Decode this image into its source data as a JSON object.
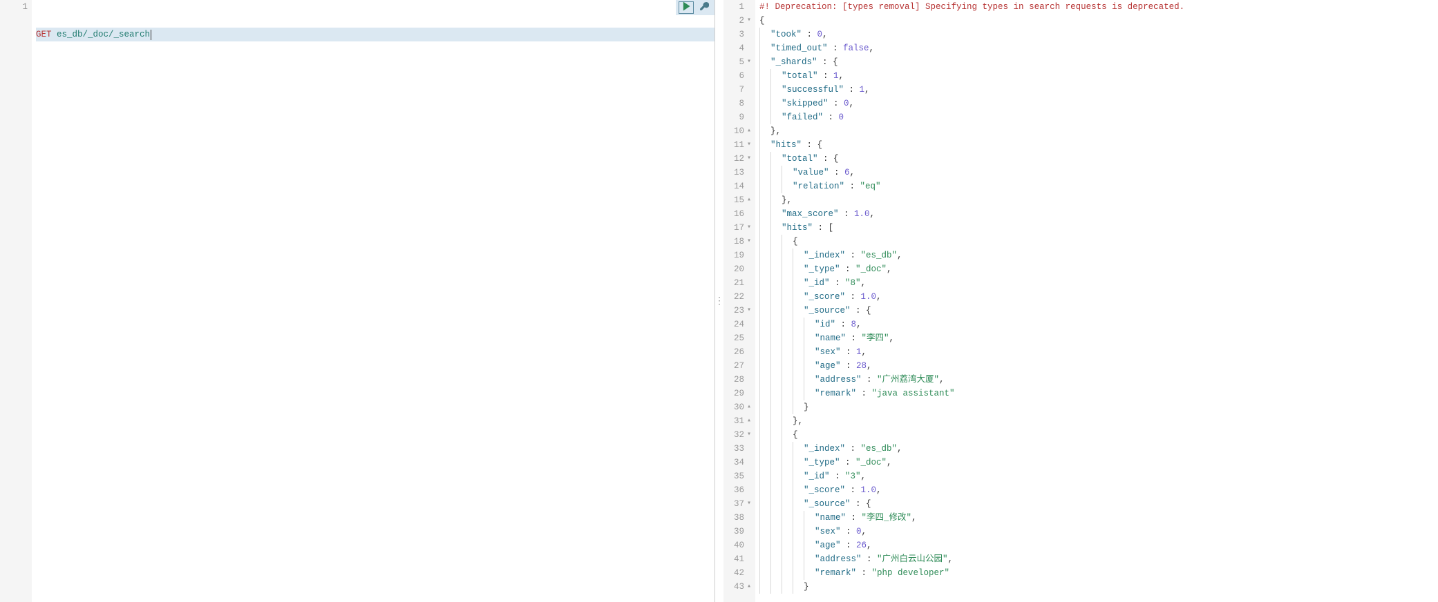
{
  "request": {
    "method": "GET",
    "path": "es_db/_doc/_search"
  },
  "response": {
    "deprecation_line": "#! Deprecation: [types removal] Specifying types in search requests is deprecated.",
    "lines": [
      {
        "n": 1,
        "fold": "",
        "type": "depr"
      },
      {
        "n": 2,
        "fold": "▾",
        "tokens": [
          [
            "punc",
            "{"
          ]
        ]
      },
      {
        "n": 3,
        "fold": "",
        "indent": 1,
        "tokens": [
          [
            "key",
            "\"took\""
          ],
          [
            "punc",
            " : "
          ],
          [
            "num",
            "0"
          ],
          [
            "punc",
            ","
          ]
        ]
      },
      {
        "n": 4,
        "fold": "",
        "indent": 1,
        "tokens": [
          [
            "key",
            "\"timed_out\""
          ],
          [
            "punc",
            " : "
          ],
          [
            "false",
            "false"
          ],
          [
            "punc",
            ","
          ]
        ]
      },
      {
        "n": 5,
        "fold": "▾",
        "indent": 1,
        "tokens": [
          [
            "key",
            "\"_shards\""
          ],
          [
            "punc",
            " : {"
          ]
        ]
      },
      {
        "n": 6,
        "fold": "",
        "indent": 2,
        "tokens": [
          [
            "key",
            "\"total\""
          ],
          [
            "punc",
            " : "
          ],
          [
            "num",
            "1"
          ],
          [
            "punc",
            ","
          ]
        ]
      },
      {
        "n": 7,
        "fold": "",
        "indent": 2,
        "tokens": [
          [
            "key",
            "\"successful\""
          ],
          [
            "punc",
            " : "
          ],
          [
            "num",
            "1"
          ],
          [
            "punc",
            ","
          ]
        ]
      },
      {
        "n": 8,
        "fold": "",
        "indent": 2,
        "tokens": [
          [
            "key",
            "\"skipped\""
          ],
          [
            "punc",
            " : "
          ],
          [
            "num",
            "0"
          ],
          [
            "punc",
            ","
          ]
        ]
      },
      {
        "n": 9,
        "fold": "",
        "indent": 2,
        "tokens": [
          [
            "key",
            "\"failed\""
          ],
          [
            "punc",
            " : "
          ],
          [
            "num",
            "0"
          ]
        ]
      },
      {
        "n": 10,
        "fold": "▴",
        "indent": 1,
        "tokens": [
          [
            "punc",
            "},"
          ]
        ]
      },
      {
        "n": 11,
        "fold": "▾",
        "indent": 1,
        "tokens": [
          [
            "key",
            "\"hits\""
          ],
          [
            "punc",
            " : {"
          ]
        ]
      },
      {
        "n": 12,
        "fold": "▾",
        "indent": 2,
        "tokens": [
          [
            "key",
            "\"total\""
          ],
          [
            "punc",
            " : {"
          ]
        ]
      },
      {
        "n": 13,
        "fold": "",
        "indent": 3,
        "tokens": [
          [
            "key",
            "\"value\""
          ],
          [
            "punc",
            " : "
          ],
          [
            "num",
            "6"
          ],
          [
            "punc",
            ","
          ]
        ]
      },
      {
        "n": 14,
        "fold": "",
        "indent": 3,
        "tokens": [
          [
            "key",
            "\"relation\""
          ],
          [
            "punc",
            " : "
          ],
          [
            "str",
            "\"eq\""
          ]
        ]
      },
      {
        "n": 15,
        "fold": "▴",
        "indent": 2,
        "tokens": [
          [
            "punc",
            "},"
          ]
        ]
      },
      {
        "n": 16,
        "fold": "",
        "indent": 2,
        "tokens": [
          [
            "key",
            "\"max_score\""
          ],
          [
            "punc",
            " : "
          ],
          [
            "num",
            "1.0"
          ],
          [
            "punc",
            ","
          ]
        ]
      },
      {
        "n": 17,
        "fold": "▾",
        "indent": 2,
        "tokens": [
          [
            "key",
            "\"hits\""
          ],
          [
            "punc",
            " : ["
          ]
        ]
      },
      {
        "n": 18,
        "fold": "▾",
        "indent": 3,
        "tokens": [
          [
            "punc",
            "{"
          ]
        ]
      },
      {
        "n": 19,
        "fold": "",
        "indent": 4,
        "tokens": [
          [
            "key",
            "\"_index\""
          ],
          [
            "punc",
            " : "
          ],
          [
            "str",
            "\"es_db\""
          ],
          [
            "punc",
            ","
          ]
        ]
      },
      {
        "n": 20,
        "fold": "",
        "indent": 4,
        "tokens": [
          [
            "key",
            "\"_type\""
          ],
          [
            "punc",
            " : "
          ],
          [
            "str",
            "\"_doc\""
          ],
          [
            "punc",
            ","
          ]
        ]
      },
      {
        "n": 21,
        "fold": "",
        "indent": 4,
        "tokens": [
          [
            "key",
            "\"_id\""
          ],
          [
            "punc",
            " : "
          ],
          [
            "str",
            "\"8\""
          ],
          [
            "punc",
            ","
          ]
        ]
      },
      {
        "n": 22,
        "fold": "",
        "indent": 4,
        "tokens": [
          [
            "key",
            "\"_score\""
          ],
          [
            "punc",
            " : "
          ],
          [
            "num",
            "1.0"
          ],
          [
            "punc",
            ","
          ]
        ]
      },
      {
        "n": 23,
        "fold": "▾",
        "indent": 4,
        "tokens": [
          [
            "key",
            "\"_source\""
          ],
          [
            "punc",
            " : {"
          ]
        ]
      },
      {
        "n": 24,
        "fold": "",
        "indent": 5,
        "tokens": [
          [
            "key",
            "\"id\""
          ],
          [
            "punc",
            " : "
          ],
          [
            "num",
            "8"
          ],
          [
            "punc",
            ","
          ]
        ]
      },
      {
        "n": 25,
        "fold": "",
        "indent": 5,
        "tokens": [
          [
            "key",
            "\"name\""
          ],
          [
            "punc",
            " : "
          ],
          [
            "str",
            "\"李四\""
          ],
          [
            "punc",
            ","
          ]
        ]
      },
      {
        "n": 26,
        "fold": "",
        "indent": 5,
        "tokens": [
          [
            "key",
            "\"sex\""
          ],
          [
            "punc",
            " : "
          ],
          [
            "num",
            "1"
          ],
          [
            "punc",
            ","
          ]
        ]
      },
      {
        "n": 27,
        "fold": "",
        "indent": 5,
        "tokens": [
          [
            "key",
            "\"age\""
          ],
          [
            "punc",
            " : "
          ],
          [
            "num",
            "28"
          ],
          [
            "punc",
            ","
          ]
        ]
      },
      {
        "n": 28,
        "fold": "",
        "indent": 5,
        "tokens": [
          [
            "key",
            "\"address\""
          ],
          [
            "punc",
            " : "
          ],
          [
            "str",
            "\"广州荔湾大厦\""
          ],
          [
            "punc",
            ","
          ]
        ]
      },
      {
        "n": 29,
        "fold": "",
        "indent": 5,
        "tokens": [
          [
            "key",
            "\"remark\""
          ],
          [
            "punc",
            " : "
          ],
          [
            "str",
            "\"java assistant\""
          ]
        ]
      },
      {
        "n": 30,
        "fold": "▴",
        "indent": 4,
        "tokens": [
          [
            "punc",
            "}"
          ]
        ]
      },
      {
        "n": 31,
        "fold": "▴",
        "indent": 3,
        "tokens": [
          [
            "punc",
            "},"
          ]
        ]
      },
      {
        "n": 32,
        "fold": "▾",
        "indent": 3,
        "tokens": [
          [
            "punc",
            "{"
          ]
        ]
      },
      {
        "n": 33,
        "fold": "",
        "indent": 4,
        "tokens": [
          [
            "key",
            "\"_index\""
          ],
          [
            "punc",
            " : "
          ],
          [
            "str",
            "\"es_db\""
          ],
          [
            "punc",
            ","
          ]
        ]
      },
      {
        "n": 34,
        "fold": "",
        "indent": 4,
        "tokens": [
          [
            "key",
            "\"_type\""
          ],
          [
            "punc",
            " : "
          ],
          [
            "str",
            "\"_doc\""
          ],
          [
            "punc",
            ","
          ]
        ]
      },
      {
        "n": 35,
        "fold": "",
        "indent": 4,
        "tokens": [
          [
            "key",
            "\"_id\""
          ],
          [
            "punc",
            " : "
          ],
          [
            "str",
            "\"3\""
          ],
          [
            "punc",
            ","
          ]
        ]
      },
      {
        "n": 36,
        "fold": "",
        "indent": 4,
        "tokens": [
          [
            "key",
            "\"_score\""
          ],
          [
            "punc",
            " : "
          ],
          [
            "num",
            "1.0"
          ],
          [
            "punc",
            ","
          ]
        ]
      },
      {
        "n": 37,
        "fold": "▾",
        "indent": 4,
        "tokens": [
          [
            "key",
            "\"_source\""
          ],
          [
            "punc",
            " : {"
          ]
        ]
      },
      {
        "n": 38,
        "fold": "",
        "indent": 5,
        "tokens": [
          [
            "key",
            "\"name\""
          ],
          [
            "punc",
            " : "
          ],
          [
            "str",
            "\"李四_修改\""
          ],
          [
            "punc",
            ","
          ]
        ]
      },
      {
        "n": 39,
        "fold": "",
        "indent": 5,
        "tokens": [
          [
            "key",
            "\"sex\""
          ],
          [
            "punc",
            " : "
          ],
          [
            "num",
            "0"
          ],
          [
            "punc",
            ","
          ]
        ]
      },
      {
        "n": 40,
        "fold": "",
        "indent": 5,
        "tokens": [
          [
            "key",
            "\"age\""
          ],
          [
            "punc",
            " : "
          ],
          [
            "num",
            "26"
          ],
          [
            "punc",
            ","
          ]
        ]
      },
      {
        "n": 41,
        "fold": "",
        "indent": 5,
        "tokens": [
          [
            "key",
            "\"address\""
          ],
          [
            "punc",
            " : "
          ],
          [
            "str",
            "\"广州白云山公园\""
          ],
          [
            "punc",
            ","
          ]
        ]
      },
      {
        "n": 42,
        "fold": "",
        "indent": 5,
        "tokens": [
          [
            "key",
            "\"remark\""
          ],
          [
            "punc",
            " : "
          ],
          [
            "str",
            "\"php developer\""
          ]
        ]
      },
      {
        "n": 43,
        "fold": "▴",
        "indent": 4,
        "tokens": [
          [
            "punc",
            "}"
          ]
        ]
      }
    ]
  }
}
